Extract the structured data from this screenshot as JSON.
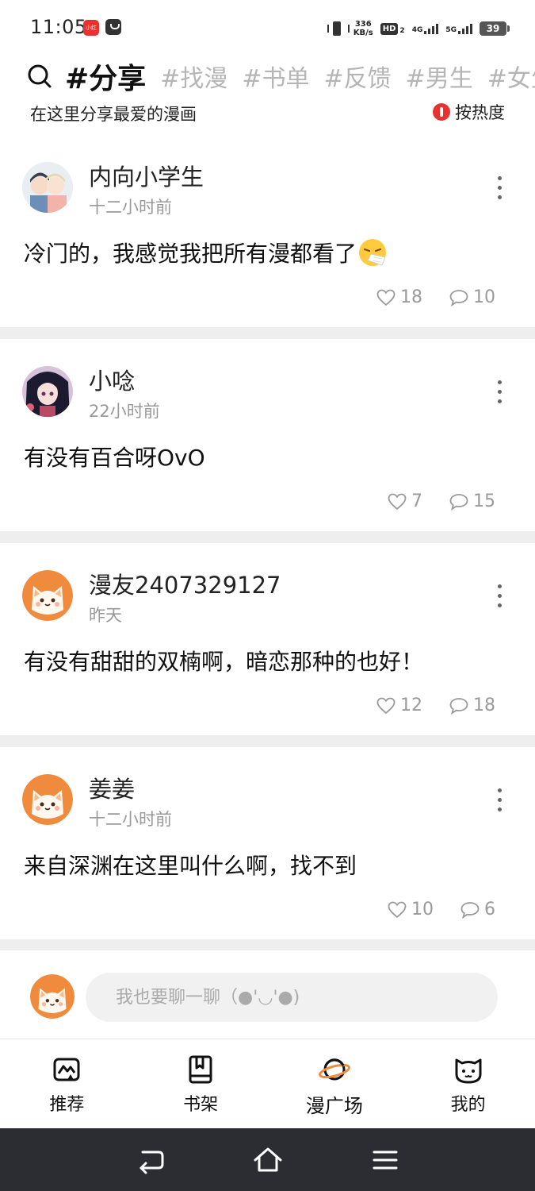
{
  "status_bar": {
    "time": "11:05",
    "app_badge_1": "小红书",
    "net_speed_value": "336",
    "net_speed_unit": "KB/s",
    "hd_label": "HD",
    "hd_sim": "2",
    "net_4g": "4G",
    "net_5g": "5G",
    "battery": "39"
  },
  "header": {
    "tags": [
      "#分享",
      "#找漫",
      "#书单",
      "#反馈",
      "#男生",
      "#女生"
    ],
    "active_tag": "#分享",
    "subtitle": "在这里分享最爱的漫画",
    "sort_label": "按热度"
  },
  "posts": [
    {
      "username": "内向小学生",
      "time": "十二小时前",
      "text": "冷门的，我感觉我把所有漫都看了",
      "emoji": "sneezing-face-emoji",
      "likes": "18",
      "comments": "10"
    },
    {
      "username": "小唸",
      "time": "22小时前",
      "text": "有没有百合呀OvO",
      "likes": "7",
      "comments": "15"
    },
    {
      "username": "漫友2407329127",
      "time": "昨天",
      "text": "有没有甜甜的双楠啊，暗恋那种的也好！",
      "likes": "12",
      "comments": "18"
    },
    {
      "username": "姜姜",
      "time": "十二小时前",
      "text": "来自深渊在这里叫什么啊，找不到",
      "likes": "10",
      "comments": "6"
    }
  ],
  "comment_box": {
    "placeholder": "我也要聊一聊（●'◡'●)"
  },
  "bottom_nav": {
    "items": [
      {
        "label": "推荐",
        "icon": "recommend-icon"
      },
      {
        "label": "书架",
        "icon": "bookshelf-icon"
      },
      {
        "label": "漫广场",
        "icon": "planet-icon",
        "active": true
      },
      {
        "label": "我的",
        "icon": "cat-face-icon"
      }
    ]
  },
  "colors": {
    "accent": "#f08a3c",
    "sort_dot": "#e8322f",
    "separator": "#eeeeee",
    "system_nav": "#2b2d33"
  }
}
